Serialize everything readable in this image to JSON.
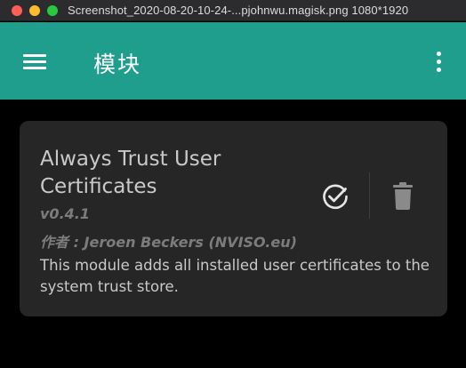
{
  "window": {
    "title": "Screenshot_2020-08-20-10-24-...pjohnwu.magisk.png  1080*1920"
  },
  "appbar": {
    "title": "模块",
    "menu_icon": "hamburger-menu-icon",
    "overflow_icon": "more-vert-icon",
    "color": "#1f9e8e"
  },
  "module": {
    "name": "Always Trust User Certificates",
    "version": "v0.4.1",
    "author": "作者 : Jeroen Beckers (NVISO.eu)",
    "description": "This module adds all installed user certificates to the system trust store.",
    "enabled": true,
    "enable_icon": "check-circle-icon",
    "delete_icon": "trash-icon"
  },
  "colors": {
    "card_background": "#262626",
    "page_background": "#000000",
    "text_primary": "#c9c9c9",
    "text_secondary": "#7c7c7c"
  }
}
